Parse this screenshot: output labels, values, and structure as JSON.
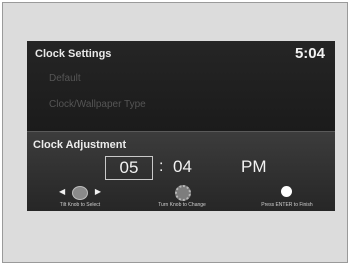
{
  "header": {
    "title": "Clock Settings",
    "time": "5:04"
  },
  "menu": {
    "items": [
      {
        "label": "Default"
      },
      {
        "label": "Clock/Wallpaper Type"
      }
    ]
  },
  "adjustment": {
    "title": "Clock Adjustment",
    "hour": "05",
    "separator": ":",
    "minutes": "04",
    "period": "PM"
  },
  "hints": [
    {
      "label": "Tilt Knob to Select",
      "icon": "tilt-knob-icon"
    },
    {
      "label": "Turn Knob to Change",
      "icon": "turn-knob-icon"
    },
    {
      "label": "Press ENTER to Finish",
      "icon": "enter-icon"
    }
  ]
}
